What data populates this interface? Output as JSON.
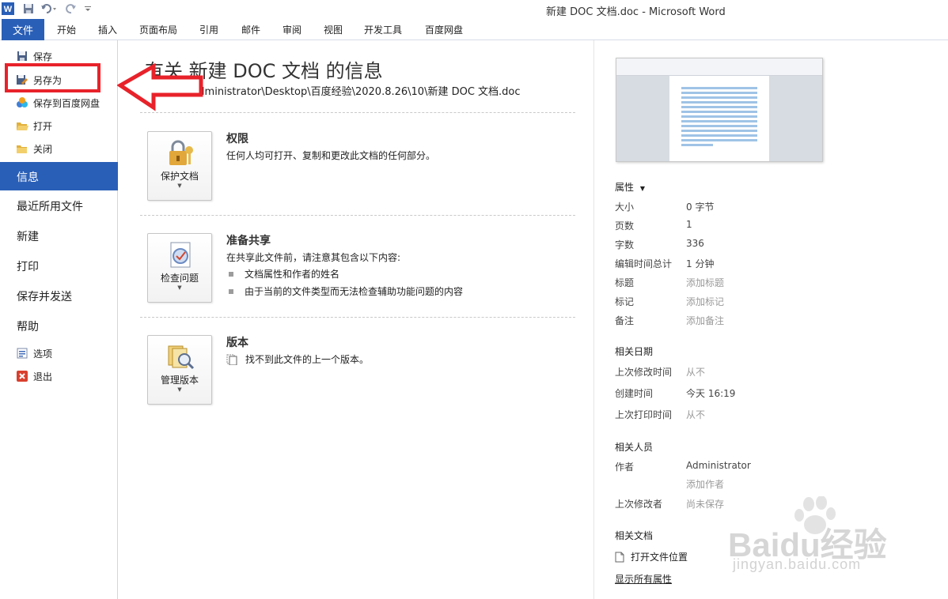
{
  "window": {
    "title": "新建 DOC 文档.doc - Microsoft Word"
  },
  "ribbon": {
    "file_tab": "文件",
    "tabs": [
      "开始",
      "插入",
      "页面布局",
      "引用",
      "邮件",
      "审阅",
      "视图",
      "开发工具",
      "百度网盘"
    ]
  },
  "backstage_nav": {
    "commands": [
      {
        "label": "保存",
        "icon": "save-icon"
      },
      {
        "label": "另存为",
        "icon": "save-as-icon"
      },
      {
        "label": "保存到百度网盘",
        "icon": "baidu-cloud-icon"
      },
      {
        "label": "打开",
        "icon": "open-folder-icon"
      },
      {
        "label": "关闭",
        "icon": "close-folder-icon"
      }
    ],
    "selected": "信息",
    "items": [
      "最近所用文件",
      "新建",
      "打印",
      "保存并发送",
      "帮助"
    ],
    "bottom": [
      {
        "label": "选项",
        "icon": "options-icon"
      },
      {
        "label": "退出",
        "icon": "exit-icon"
      }
    ]
  },
  "info": {
    "title": "有关 新建 DOC 文档 的信息",
    "path": "C:\\Users\\Administrator\\Desktop\\百度经验\\2020.8.26\\10\\新建 DOC 文档.doc",
    "sections": {
      "permissions": {
        "button": "保护文档",
        "title": "权限",
        "text": "任何人均可打开、复制和更改此文档的任何部分。"
      },
      "prepare": {
        "button": "检查问题",
        "title": "准备共享",
        "text": "在共享此文件前，请注意其包含以下内容:",
        "bullets": [
          "文档属性和作者的姓名",
          "由于当前的文件类型而无法检查辅助功能问题的内容"
        ]
      },
      "versions": {
        "button": "管理版本",
        "title": "版本",
        "text": "找不到此文件的上一个版本。"
      }
    }
  },
  "properties": {
    "header": "属性",
    "rows": [
      {
        "label": "大小",
        "value": "0 字节"
      },
      {
        "label": "页数",
        "value": "1"
      },
      {
        "label": "字数",
        "value": "336"
      },
      {
        "label": "编辑时间总计",
        "value": "1 分钟"
      },
      {
        "label": "标题",
        "value": "添加标题"
      },
      {
        "label": "标记",
        "value": "添加标记"
      },
      {
        "label": "备注",
        "value": "添加备注"
      }
    ],
    "dates_header": "相关日期",
    "dates": [
      {
        "label": "上次修改时间",
        "value": "从不"
      },
      {
        "label": "创建时间",
        "value": "今天 16:19"
      },
      {
        "label": "上次打印时间",
        "value": "从不"
      }
    ],
    "people_header": "相关人员",
    "people": {
      "author_label": "作者",
      "author": "Administrator",
      "add_author": "添加作者",
      "last_modified_label": "上次修改者",
      "last_modified": "尚未保存"
    },
    "docs_header": "相关文档",
    "open_location": "打开文件位置",
    "show_all": "显示所有属性"
  },
  "watermark": {
    "text": "Baidu经验",
    "url": "jingyan.baidu.com"
  },
  "colors": {
    "accent": "#2a5fb7",
    "annotation_red": "#e8222a"
  }
}
